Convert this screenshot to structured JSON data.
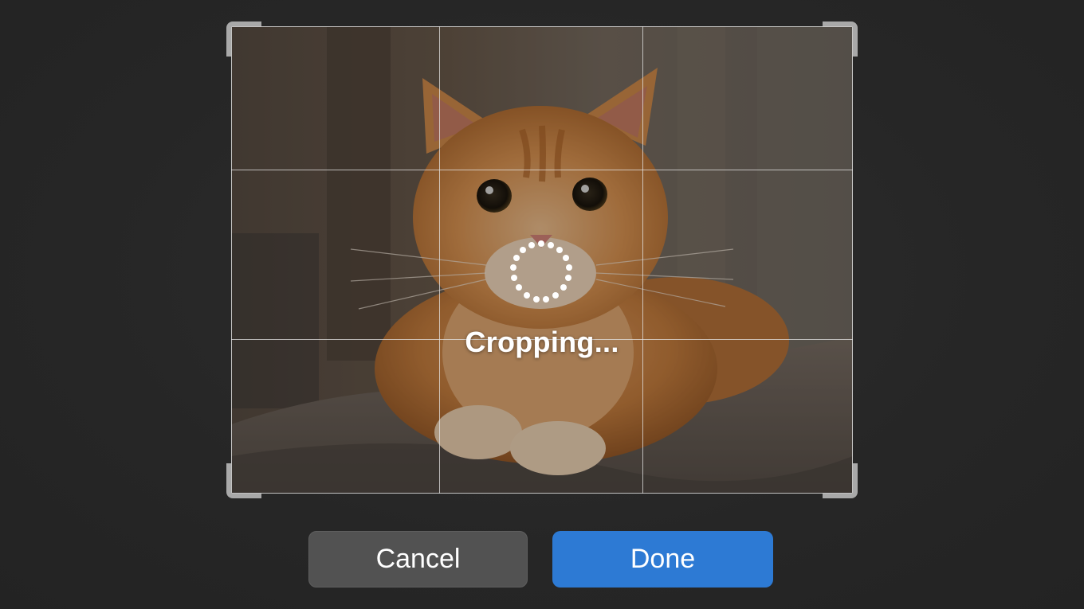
{
  "crop": {
    "status_text": "Cropping...",
    "photo_subject": "orange tabby cat lying on a grey cushion"
  },
  "buttons": {
    "cancel_label": "Cancel",
    "done_label": "Done"
  },
  "colors": {
    "background": "#272727",
    "cancel_bg": "#525252",
    "done_bg": "#2d7ad4",
    "handle": "#a9a9a9",
    "grid": "#e6e6e6"
  },
  "icons": {
    "spinner": "loading-spinner-icon"
  }
}
